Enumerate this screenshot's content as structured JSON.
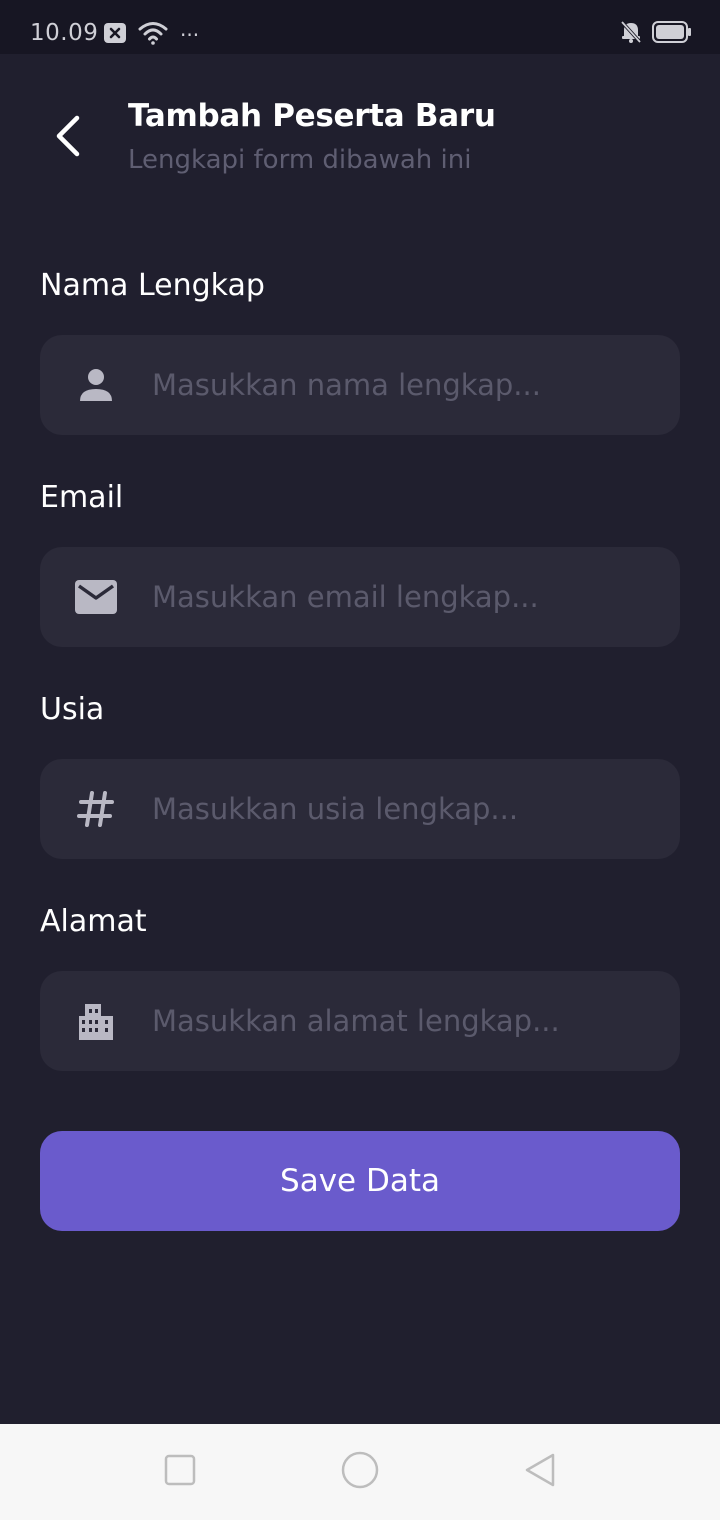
{
  "status_bar": {
    "time": "10.09",
    "more_indicator": "···",
    "icons": [
      "notification-x-icon",
      "wifi-icon",
      "more-icon",
      "bell-off-icon",
      "battery-icon"
    ]
  },
  "header": {
    "back_icon": "chevron-left-icon",
    "title": "Tambah Peserta Baru",
    "subtitle": "Lengkapi form dibawah ini"
  },
  "form": {
    "fields": [
      {
        "label": "Nama Lengkap",
        "placeholder": "Masukkan nama lengkap...",
        "value": "",
        "icon": "person-icon"
      },
      {
        "label": "Email",
        "placeholder": "Masukkan email lengkap...",
        "value": "",
        "icon": "mail-icon"
      },
      {
        "label": "Usia",
        "placeholder": "Masukkan usia lengkap...",
        "value": "",
        "icon": "hash-icon"
      },
      {
        "label": "Alamat",
        "placeholder": "Masukkan alamat lengkap...",
        "value": "",
        "icon": "building-icon"
      }
    ],
    "submit_label": "Save Data"
  },
  "nav_bar": {
    "buttons": [
      "recents-square-icon",
      "home-circle-icon",
      "back-triangle-icon"
    ]
  },
  "colors": {
    "background": "#201f2e",
    "input_background": "#2b2a39",
    "accent": "#6a5bcc",
    "placeholder": "#5b5a6c",
    "icon": "#b9b8c4"
  }
}
